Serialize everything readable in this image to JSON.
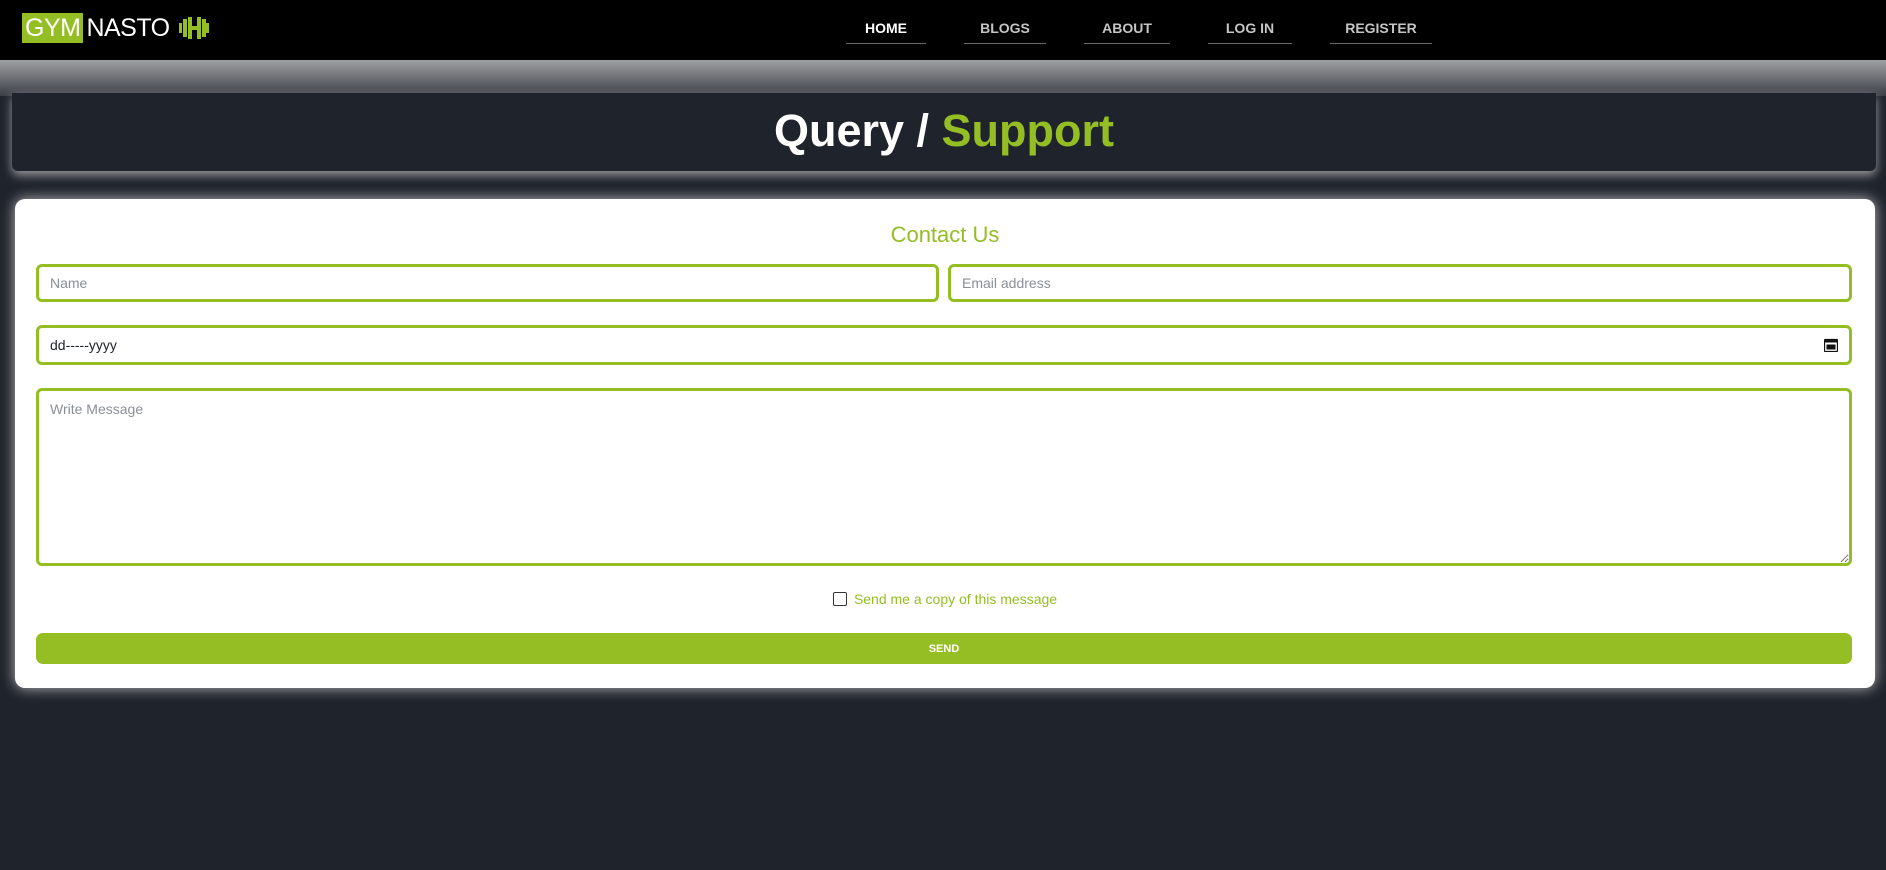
{
  "brand": {
    "part1": "GYM",
    "part2": "NASTO",
    "icon": "dumbbell-icon",
    "accent_color": "#95bd24"
  },
  "nav": {
    "items": [
      {
        "label": "HOME",
        "active": true
      },
      {
        "label": "BLOGS",
        "active": false
      },
      {
        "label": "ABOUT",
        "active": false
      },
      {
        "label": "LOG IN",
        "active": false
      },
      {
        "label": "REGISTER",
        "active": false
      }
    ]
  },
  "banner": {
    "title_part1": "Query / ",
    "title_part2": "Support"
  },
  "form": {
    "title": "Contact Us",
    "name_placeholder": "Name",
    "email_placeholder": "Email address",
    "date_value": "dd-----yyyy",
    "date_icon": "calendar-icon",
    "message_placeholder": "Write Message",
    "copy_checkbox_label": "Send me a copy of this message",
    "copy_checked": false,
    "send_label": "SEND"
  },
  "colors": {
    "page_bg": "#1f232b",
    "navbar_bg": "#000000",
    "accent": "#95bd24"
  }
}
